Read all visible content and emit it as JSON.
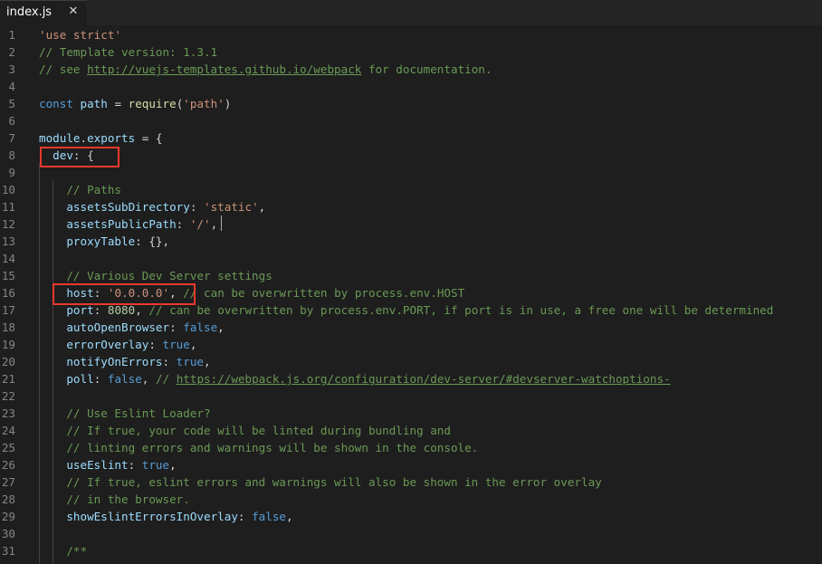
{
  "tab": {
    "label": "index.js",
    "close": "✕"
  },
  "editor": {
    "lines": [
      {
        "n": "1",
        "tokens": [
          {
            "t": "'use strict'",
            "c": "st"
          }
        ]
      },
      {
        "n": "2",
        "tokens": [
          {
            "t": "// Template version: 1.3.1",
            "c": "cm"
          }
        ]
      },
      {
        "n": "3",
        "tokens": [
          {
            "t": "// see ",
            "c": "cm"
          },
          {
            "t": "http://vuejs-templates.github.io/webpack",
            "c": "cm ul"
          },
          {
            "t": " for documentation.",
            "c": "cm"
          }
        ]
      },
      {
        "n": "4",
        "tokens": []
      },
      {
        "n": "5",
        "tokens": [
          {
            "t": "const",
            "c": "kw"
          },
          {
            "t": " "
          },
          {
            "t": "path",
            "c": "pr"
          },
          {
            "t": " = "
          },
          {
            "t": "require",
            "c": "fn"
          },
          {
            "t": "("
          },
          {
            "t": "'path'",
            "c": "st"
          },
          {
            "t": ")"
          }
        ]
      },
      {
        "n": "6",
        "tokens": []
      },
      {
        "n": "7",
        "tokens": [
          {
            "t": "module",
            "c": "pr"
          },
          {
            "t": "."
          },
          {
            "t": "exports",
            "c": "pr"
          },
          {
            "t": " = {"
          }
        ]
      },
      {
        "n": "8",
        "tokens": [
          {
            "t": "  "
          },
          {
            "t": "dev",
            "c": "pr"
          },
          {
            "t": ": {"
          }
        ]
      },
      {
        "n": "9",
        "tokens": []
      },
      {
        "n": "10",
        "tokens": [
          {
            "t": "    "
          },
          {
            "t": "// Paths",
            "c": "cm"
          }
        ]
      },
      {
        "n": "11",
        "tokens": [
          {
            "t": "    "
          },
          {
            "t": "assetsSubDirectory",
            "c": "pr"
          },
          {
            "t": ": "
          },
          {
            "t": "'static'",
            "c": "st"
          },
          {
            "t": ","
          }
        ]
      },
      {
        "n": "12",
        "tokens": [
          {
            "t": "    "
          },
          {
            "t": "assetsPublicPath",
            "c": "pr"
          },
          {
            "t": ": "
          },
          {
            "t": "'/'",
            "c": "st"
          },
          {
            "t": ","
          }
        ]
      },
      {
        "n": "13",
        "tokens": [
          {
            "t": "    "
          },
          {
            "t": "proxyTable",
            "c": "pr"
          },
          {
            "t": ": {},"
          }
        ]
      },
      {
        "n": "14",
        "tokens": []
      },
      {
        "n": "15",
        "tokens": [
          {
            "t": "    "
          },
          {
            "t": "// Various Dev Server settings",
            "c": "cm"
          }
        ]
      },
      {
        "n": "16",
        "tokens": [
          {
            "t": "    "
          },
          {
            "t": "host",
            "c": "pr"
          },
          {
            "t": ": "
          },
          {
            "t": "'0.0.0.0'",
            "c": "st"
          },
          {
            "t": ", "
          },
          {
            "t": "// can be overwritten by process.env.HOST",
            "c": "cm"
          }
        ]
      },
      {
        "n": "17",
        "tokens": [
          {
            "t": "    "
          },
          {
            "t": "port",
            "c": "pr"
          },
          {
            "t": ": "
          },
          {
            "t": "8080",
            "c": "nu"
          },
          {
            "t": ", "
          },
          {
            "t": "// can be overwritten by process.env.PORT, if port is in use, a free one will be determined",
            "c": "cm"
          }
        ]
      },
      {
        "n": "18",
        "tokens": [
          {
            "t": "    "
          },
          {
            "t": "autoOpenBrowser",
            "c": "pr"
          },
          {
            "t": ": "
          },
          {
            "t": "false",
            "c": "kw"
          },
          {
            "t": ","
          }
        ]
      },
      {
        "n": "19",
        "tokens": [
          {
            "t": "    "
          },
          {
            "t": "errorOverlay",
            "c": "pr"
          },
          {
            "t": ": "
          },
          {
            "t": "true",
            "c": "kw"
          },
          {
            "t": ","
          }
        ]
      },
      {
        "n": "20",
        "tokens": [
          {
            "t": "    "
          },
          {
            "t": "notifyOnErrors",
            "c": "pr"
          },
          {
            "t": ": "
          },
          {
            "t": "true",
            "c": "kw"
          },
          {
            "t": ","
          }
        ]
      },
      {
        "n": "21",
        "tokens": [
          {
            "t": "    "
          },
          {
            "t": "poll",
            "c": "pr"
          },
          {
            "t": ": "
          },
          {
            "t": "false",
            "c": "kw"
          },
          {
            "t": ", "
          },
          {
            "t": "// ",
            "c": "cm"
          },
          {
            "t": "https://webpack.js.org/configuration/dev-server/#devserver-watchoptions-",
            "c": "cm ul"
          }
        ]
      },
      {
        "n": "22",
        "tokens": []
      },
      {
        "n": "23",
        "tokens": [
          {
            "t": "    "
          },
          {
            "t": "// Use Eslint Loader?",
            "c": "cm"
          }
        ]
      },
      {
        "n": "24",
        "tokens": [
          {
            "t": "    "
          },
          {
            "t": "// If true, your code will be linted during bundling and",
            "c": "cm"
          }
        ]
      },
      {
        "n": "25",
        "tokens": [
          {
            "t": "    "
          },
          {
            "t": "// linting errors and warnings will be shown in the console.",
            "c": "cm"
          }
        ]
      },
      {
        "n": "26",
        "tokens": [
          {
            "t": "    "
          },
          {
            "t": "useEslint",
            "c": "pr"
          },
          {
            "t": ": "
          },
          {
            "t": "true",
            "c": "kw"
          },
          {
            "t": ","
          }
        ]
      },
      {
        "n": "27",
        "tokens": [
          {
            "t": "    "
          },
          {
            "t": "// If true, eslint errors and warnings will also be shown in the error overlay",
            "c": "cm"
          }
        ]
      },
      {
        "n": "28",
        "tokens": [
          {
            "t": "    "
          },
          {
            "t": "// in the browser.",
            "c": "cm"
          }
        ]
      },
      {
        "n": "29",
        "tokens": [
          {
            "t": "    "
          },
          {
            "t": "showEslintErrorsInOverlay",
            "c": "pr"
          },
          {
            "t": ": "
          },
          {
            "t": "false",
            "c": "kw"
          },
          {
            "t": ","
          }
        ]
      },
      {
        "n": "30",
        "tokens": []
      },
      {
        "n": "31",
        "tokens": [
          {
            "t": "    "
          },
          {
            "t": "/**",
            "c": "cm"
          }
        ]
      }
    ]
  },
  "colors": {
    "background": "#1e1e1e",
    "highlight_box": "#e8392d",
    "keyword": "#569cd6",
    "string": "#ce9178",
    "comment": "#6a9955",
    "property": "#9cdcfe"
  },
  "icons": {
    "tab_close": "close-icon"
  }
}
